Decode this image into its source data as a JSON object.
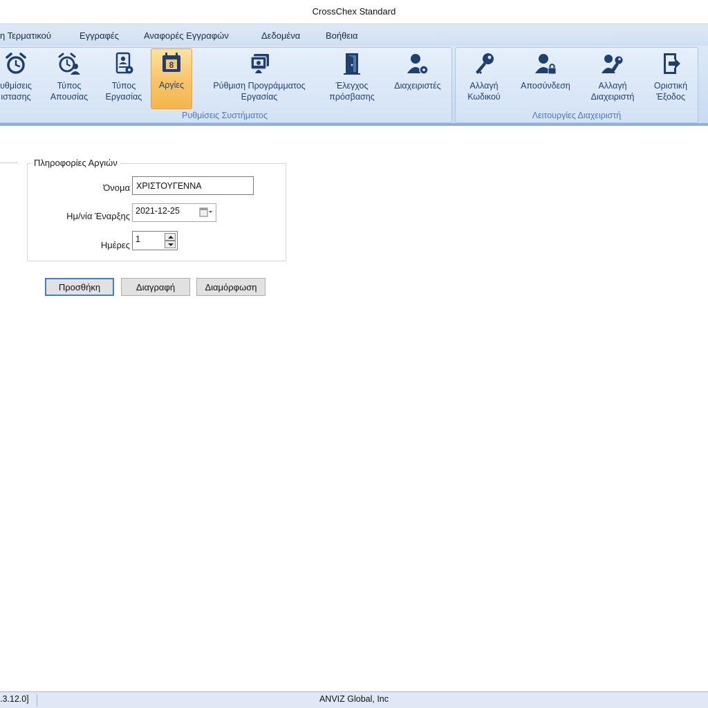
{
  "window": {
    "title": "CrossChex Standard"
  },
  "menu": [
    "η Τερματικού",
    "Εγγραφές",
    "Αναφορές Εγγραφών",
    "Δεδομένα",
    "Βοήθεια"
  ],
  "ribbon": {
    "group1": {
      "label": "Ρυθμίσεις Συστήματος",
      "buttons": [
        {
          "label": "υθμίσεις\nιστασης",
          "icon": "alarm-clock-icon"
        },
        {
          "label": "Τύπος\nΑπουσίας",
          "icon": "absence-clock-icon"
        },
        {
          "label": "Τύπος\nΕργασίας",
          "icon": "work-type-icon"
        },
        {
          "label": "Αργίες",
          "icon": "calendar-icon"
        },
        {
          "label": "Ρύθμιση Προγράμματος\nΕργασίας",
          "icon": "schedule-icon"
        },
        {
          "label": "Έλεγχος\nπρόσβασης",
          "icon": "door-icon"
        },
        {
          "label": "Διαχειριστές",
          "icon": "admin-gear-icon"
        }
      ]
    },
    "group2": {
      "label": "Λειτουργίες Διαχειριστή",
      "buttons": [
        {
          "label": "Αλλαγή\nΚωδικού",
          "icon": "key-icon"
        },
        {
          "label": "Αποσύνδεση",
          "icon": "user-lock-icon"
        },
        {
          "label": "Αλλαγή\nΔιαχειριστή",
          "icon": "user-key-icon"
        },
        {
          "label": "Οριστική\nΈξοδος",
          "icon": "exit-icon"
        }
      ]
    }
  },
  "form": {
    "legend": "Πληροφορίες Αργιών",
    "name_label": "Όνομα",
    "name_value": "ΧΡΙΣΤΟΥΓΕΝΝΑ",
    "start_label": "Ημ/νία Έναρξης",
    "start_value": "2021-12-25",
    "days_label": "Ημέρες",
    "days_value": "1"
  },
  "actions": {
    "add": "Προσθήκη",
    "delete": "Διαγραφή",
    "configure": "Διαμόρφωση"
  },
  "status": {
    "version": ".3.12.0]",
    "company": "ANVIZ Global, Inc"
  },
  "colors": {
    "ribbon": "#c9dbf1",
    "active": "#f9c56b",
    "icon": "#1f3f6f",
    "group_label": "#4a79b6"
  }
}
